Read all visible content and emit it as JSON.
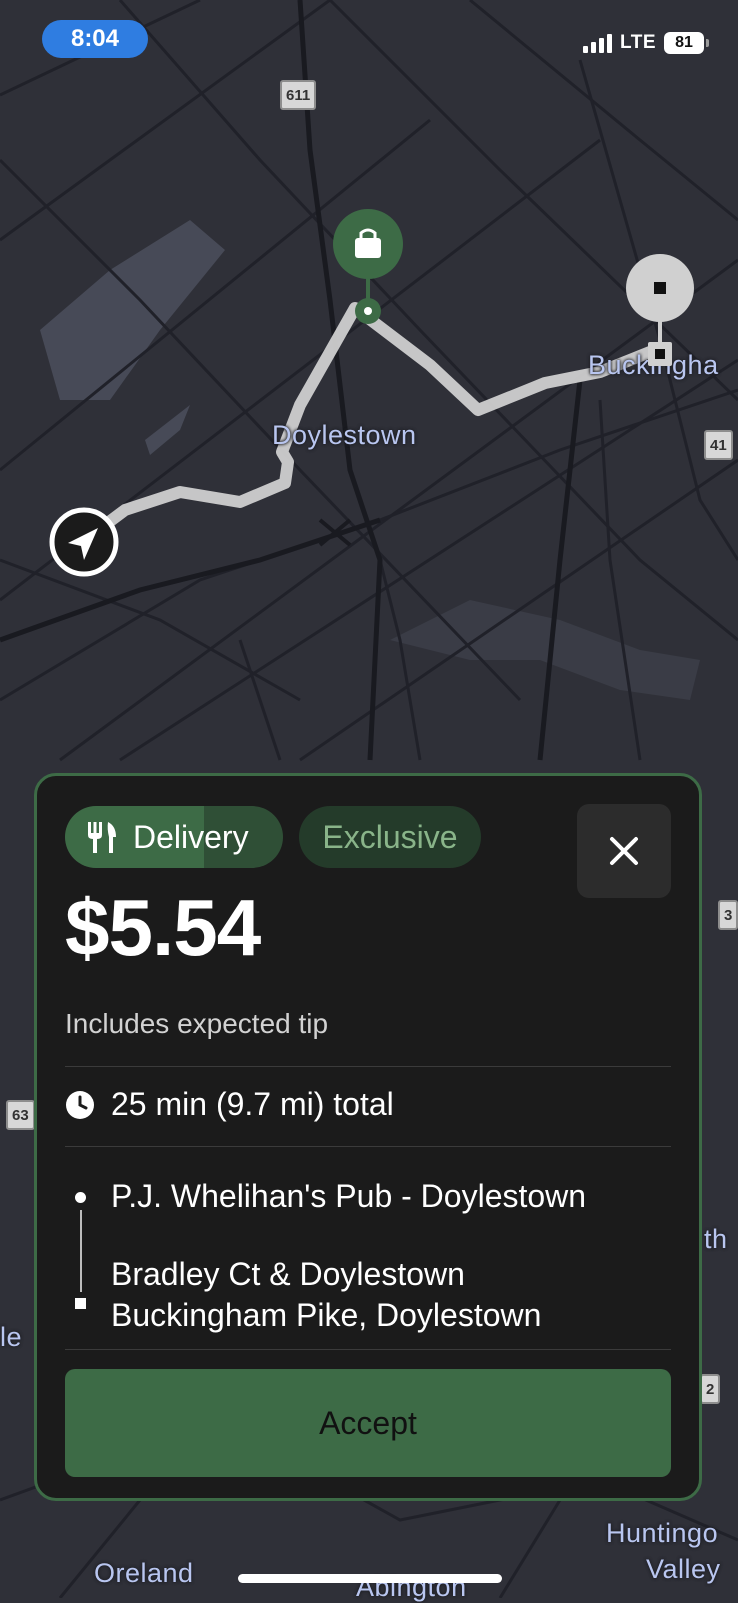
{
  "status_bar": {
    "time": "8:04",
    "network": "LTE",
    "battery": "81"
  },
  "map": {
    "place_labels": [
      "Doylestown",
      "Buckingha",
      "Oreland",
      "Abington",
      "Huntingo",
      "Valley",
      "le",
      "th"
    ],
    "route_shields": [
      "611",
      "41",
      "63",
      "3",
      "2"
    ],
    "markers": [
      "current-location",
      "pickup-bag",
      "dropoff-square"
    ]
  },
  "offer": {
    "category_chip": "Delivery",
    "exclusive_chip": "Exclusive",
    "price": "$5.54",
    "price_note": "Includes expected tip",
    "duration": "25 min (9.7 mi) total",
    "pickup": "P.J. Whelihan's Pub - Doylestown",
    "dropoff_line1": "Bradley Ct & Doylestown",
    "dropoff_line2": "Buckingham Pike, Doylestown",
    "accept_label": "Accept"
  },
  "colors": {
    "accent_green": "#3d6b46",
    "card_background": "#1b1b1b",
    "map_background": "#2f3038",
    "time_pill": "#2f7de1"
  },
  "icons": [
    "fork-knife-icon",
    "close-icon",
    "clock-icon",
    "navigation-arrow-icon",
    "shopping-bag-icon",
    "dropoff-square-icon",
    "signal-icon",
    "battery-icon"
  ]
}
